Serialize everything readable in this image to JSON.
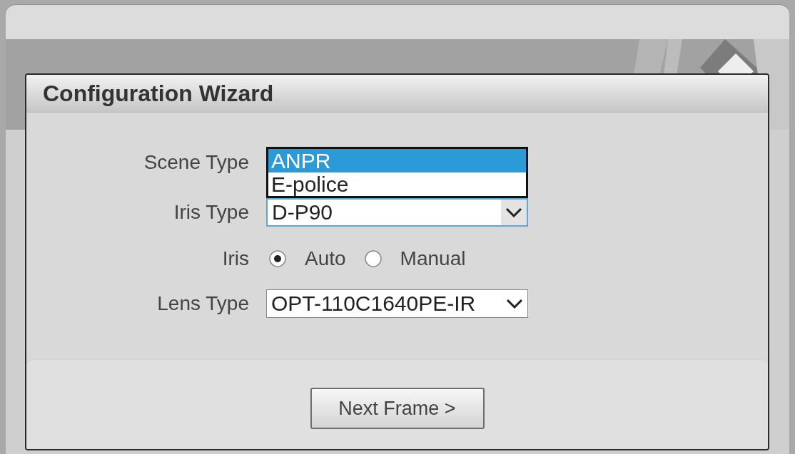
{
  "dialog": {
    "title": "Configuration Wizard",
    "fields": [
      {
        "kind": "select",
        "label": "Scene Type",
        "open": true,
        "options": [
          {
            "label": "ANPR",
            "selected": true
          },
          {
            "label": "E-police",
            "selected": false
          }
        ]
      },
      {
        "kind": "select",
        "label": "Iris Type",
        "value": "D-P90",
        "focused": true
      },
      {
        "kind": "radio",
        "label": "Iris",
        "options": [
          {
            "label": "Auto",
            "selected": true
          },
          {
            "label": "Manual",
            "selected": false
          }
        ]
      },
      {
        "kind": "select",
        "label": "Lens Type",
        "value": "OPT-110C1640PE-IR",
        "focused": false
      }
    ],
    "buttons": [
      {
        "label": "Next Frame >"
      }
    ]
  }
}
